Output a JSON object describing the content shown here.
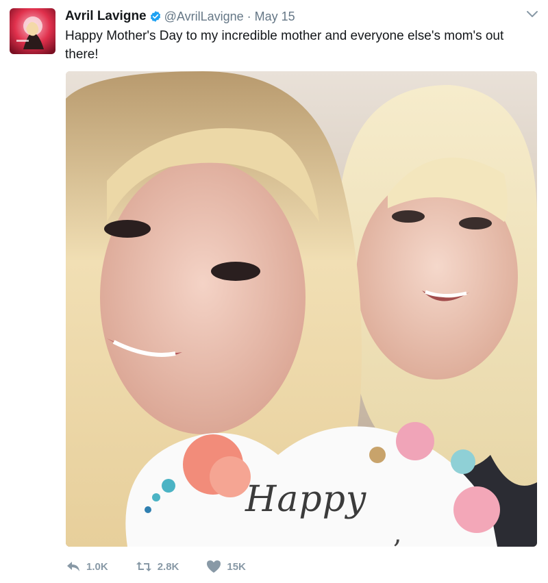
{
  "tweet": {
    "display_name": "Avril Lavigne",
    "handle": "@AvrilLavigne",
    "separator": "·",
    "timestamp": "May 15",
    "text": "Happy Mother's Day to my incredible mother and everyone else's mom's out there!",
    "photo_caption": "Happy"
  },
  "actions": {
    "reply_count": "1.0K",
    "retweet_count": "2.8K",
    "like_count": "15K"
  },
  "colors": {
    "text_primary": "#14171a",
    "text_secondary": "#657786",
    "verified_blue": "#1da1f2",
    "action_gray": "#8899a6"
  },
  "icons": {
    "verified": "verified-badge-icon",
    "menu": "chevron-down-icon",
    "reply": "reply-icon",
    "retweet": "retweet-icon",
    "like": "heart-icon"
  }
}
